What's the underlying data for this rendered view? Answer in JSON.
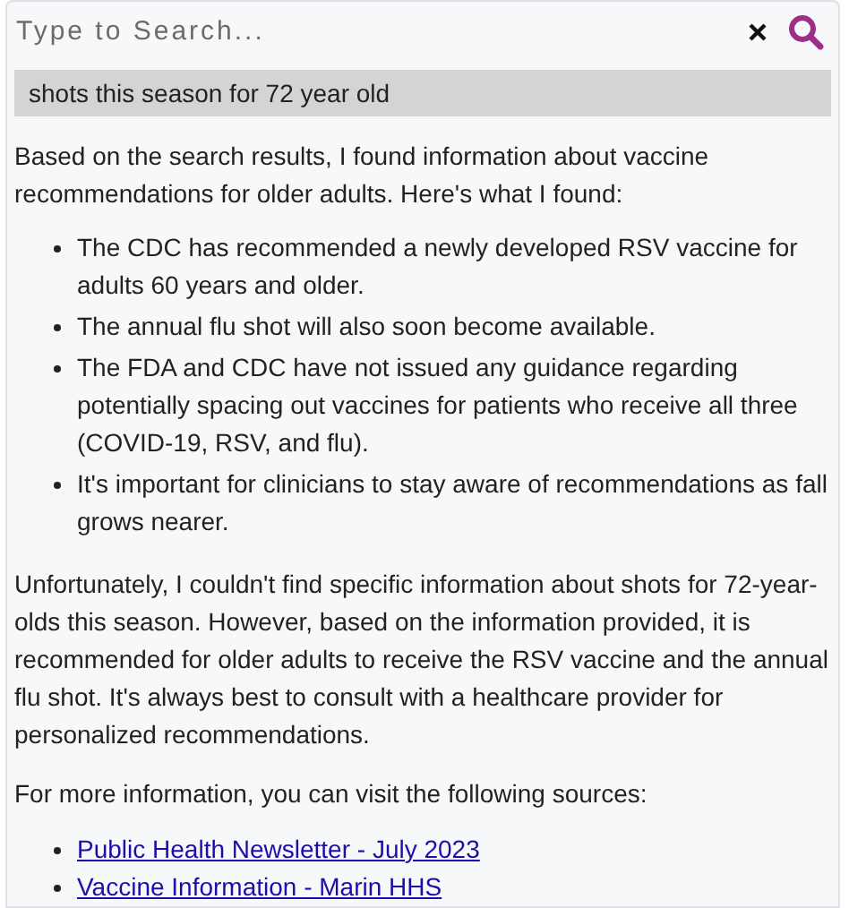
{
  "search": {
    "placeholder": "Type to Search..."
  },
  "query": "shots this season for 72 year old",
  "answer": {
    "intro": "Based on the search results, I found information about vaccine recommendations for older adults. Here's what I found:",
    "points": [
      "The CDC has recommended a newly developed RSV vaccine for adults 60 years and older.",
      "The annual flu shot will also soon become available.",
      "The FDA and CDC have not issued any guidance regarding potentially spacing out vaccines for patients who receive all three (COVID-19, RSV, and flu).",
      "It's important for clinicians to stay aware of recommendations as fall grows nearer."
    ],
    "summary": "Unfortunately, I couldn't find specific information about shots for 72-year-olds this season. However, based on the information provided, it is recommended for older adults to receive the RSV vaccine and the annual flu shot. It's always best to consult with a healthcare provider for personalized recommendations.",
    "sources_intro": "For more information, you can visit the following sources:",
    "sources": [
      "Public Health Newsletter - July 2023",
      "Vaccine Information - Marin HHS"
    ]
  }
}
